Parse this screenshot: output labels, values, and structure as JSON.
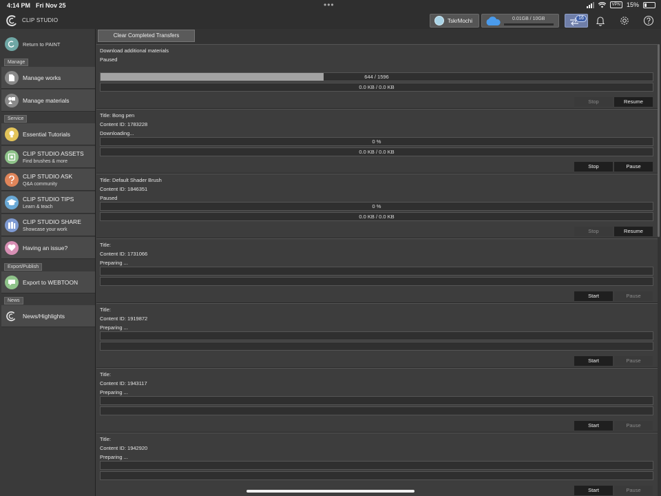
{
  "status_bar": {
    "time": "4:14 PM",
    "date": "Fri Nov 25",
    "battery": "15%",
    "vpn": "VPN"
  },
  "header": {
    "brand": "CLIP STUDIO",
    "user_name": "TskrMochi",
    "storage_text": "0.01GB / 10GB",
    "storage_used_fraction": 0.001,
    "transfer_count": "16"
  },
  "sidebar": {
    "return_label": "Return to PAINT",
    "sections": {
      "manage": "Manage",
      "service": "Service",
      "export": "Export/Publish",
      "news": "News"
    },
    "items": {
      "manage_works": "Manage works",
      "manage_materials": "Manage materials",
      "tutorials": "Essential Tutorials",
      "assets_title": "CLIP STUDIO ASSETS",
      "assets_sub": "Find brushes & more",
      "ask_title": "CLIP STUDIO ASK",
      "ask_sub": "Q&A community",
      "tips_title": "CLIP STUDIO TIPS",
      "tips_sub": "Learn & teach",
      "share_title": "CLIP STUDIO SHARE",
      "share_sub": "Showcase your work",
      "issue": "Having an issue?",
      "webtoon": "Export to WEBTOON",
      "news": "News/Highlights"
    },
    "colors": {
      "return": "#6fa7a5",
      "works": "#8a8a8a",
      "materials": "#8a8a8a",
      "tutorials": "#e3c45a",
      "assets": "#8fc38a",
      "ask": "#e0855a",
      "tips": "#6aa9d6",
      "share": "#7e9ad2",
      "issue": "#d78fb4",
      "webtoon": "#8fc38a",
      "news": "#8a8a8a"
    }
  },
  "main": {
    "clear_button": "Clear Completed Transfers",
    "transfers": [
      {
        "line1": "Download additional materials",
        "line2": "Paused",
        "line3": "",
        "progress_text": "644 / 1596",
        "progress_fraction": 0.4035,
        "size_text": "0.0 KB / 0.0 KB",
        "btn1": "Stop",
        "btn1_enabled": false,
        "btn2": "Resume",
        "btn2_enabled": true
      },
      {
        "line1": "Title: Bong pen",
        "line2": "Content ID: 1783228",
        "line3": "Downloading...",
        "progress_text": "0 %",
        "progress_fraction": 0,
        "size_text": "0.0 KB / 0.0 KB",
        "btn1": "Stop",
        "btn1_enabled": true,
        "btn2": "Pause",
        "btn2_enabled": true
      },
      {
        "line1": "Title: Default Shader Brush",
        "line2": "Content ID: 1846351",
        "line3": "Paused",
        "progress_text": "0 %",
        "progress_fraction": 0,
        "size_text": "0.0 KB / 0.0 KB",
        "btn1": "Stop",
        "btn1_enabled": false,
        "btn2": "Resume",
        "btn2_enabled": true
      },
      {
        "line1": "Title:",
        "line2": "Content ID: 1731066",
        "line3": "Preparing ...",
        "progress_text": "",
        "progress_fraction": 0,
        "size_text": "",
        "btn1": "Start",
        "btn1_enabled": true,
        "btn2": "Pause",
        "btn2_enabled": false
      },
      {
        "line1": "Title:",
        "line2": "Content ID: 1919872",
        "line3": "Preparing ...",
        "progress_text": "",
        "progress_fraction": 0,
        "size_text": "",
        "btn1": "Start",
        "btn1_enabled": true,
        "btn2": "Pause",
        "btn2_enabled": false
      },
      {
        "line1": "Title:",
        "line2": "Content ID: 1943117",
        "line3": "Preparing ...",
        "progress_text": "",
        "progress_fraction": 0,
        "size_text": "",
        "btn1": "Start",
        "btn1_enabled": true,
        "btn2": "Pause",
        "btn2_enabled": false
      },
      {
        "line1": "Title:",
        "line2": "Content ID: 1942920",
        "line3": "Preparing ...",
        "progress_text": "",
        "progress_fraction": 0,
        "size_text": "",
        "btn1": "Start",
        "btn1_enabled": true,
        "btn2": "Pause",
        "btn2_enabled": false
      }
    ]
  }
}
